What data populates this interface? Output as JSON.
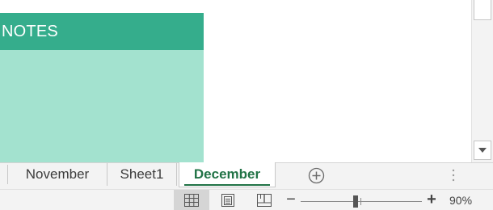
{
  "sheet": {
    "notes_header": "NOTES",
    "colors": {
      "header_bg": "#35ad8c",
      "body_bg": "#a3e2cf"
    }
  },
  "scrollbar": {
    "down_icon": "chevron-down-icon"
  },
  "tabs": {
    "items": [
      {
        "label": "November",
        "active": false
      },
      {
        "label": "Sheet1",
        "active": false
      },
      {
        "label": "December",
        "active": true
      }
    ],
    "add_icon": "plus-circle-icon",
    "active_color": "#217346"
  },
  "statusbar": {
    "views": [
      "normal-view-icon",
      "page-layout-view-icon",
      "page-break-preview-icon"
    ],
    "zoom_minus": "−",
    "zoom_plus": "+",
    "zoom_level": "90%",
    "zoom_value": 90
  }
}
